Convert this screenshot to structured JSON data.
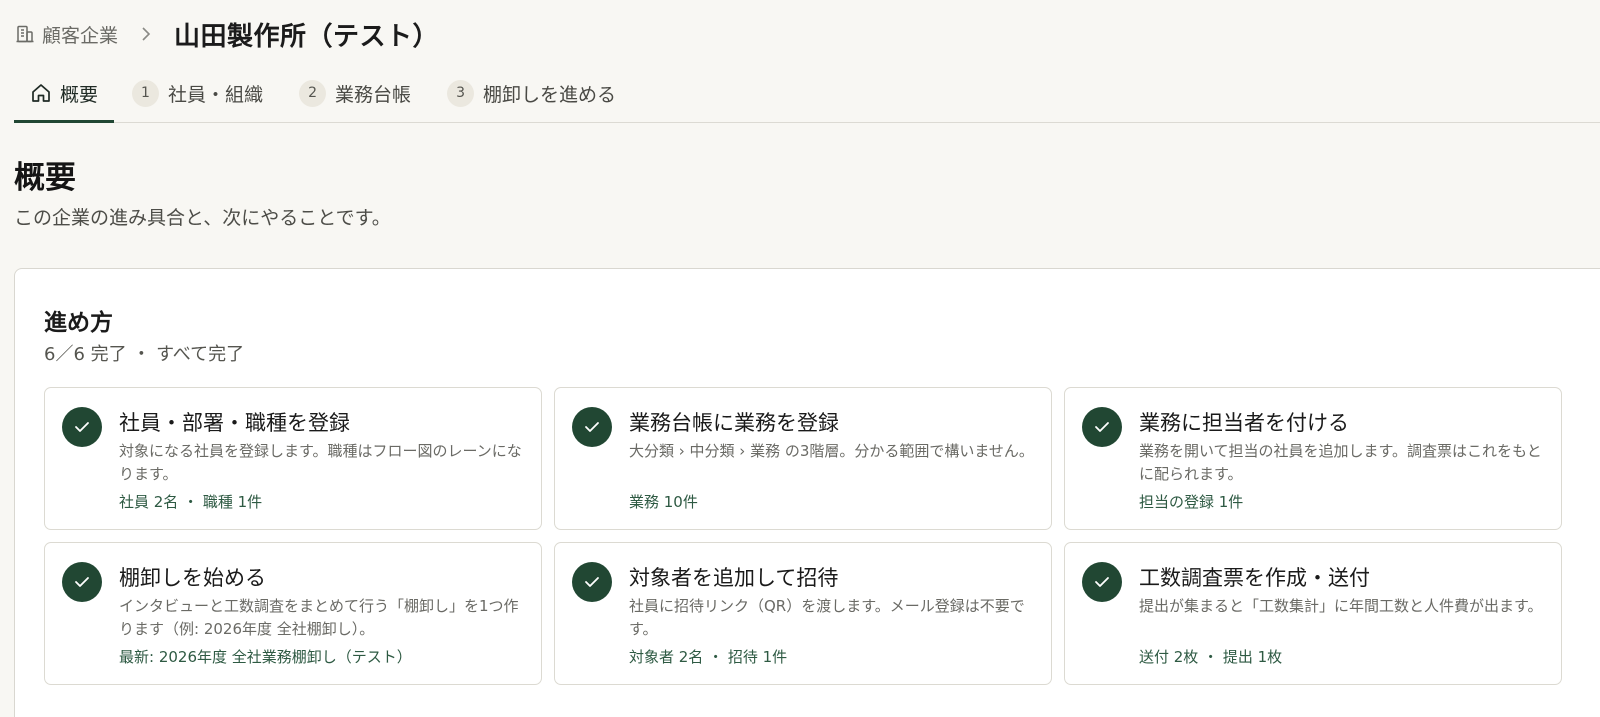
{
  "breadcrumb": {
    "parent_label": "顧客企業",
    "parent_icon": "building-icon",
    "separator": "›",
    "current_title": "山田製作所（テスト）"
  },
  "tabs": [
    {
      "label": "概要",
      "icon": "home-icon",
      "active": true
    },
    {
      "number": "1",
      "label": "社員・組織",
      "active": false
    },
    {
      "number": "2",
      "label": "業務台帳",
      "active": false
    },
    {
      "number": "3",
      "label": "棚卸しを進める",
      "active": false
    }
  ],
  "page": {
    "title": "概要",
    "subtitle": "この企業の進み具合と、次にやることです。"
  },
  "progress": {
    "title": "進め方",
    "summary": "6／6 完了 ・ すべて完了",
    "completed": 6,
    "total": 6,
    "accent_color": "#214733",
    "steps": [
      {
        "title": "社員・部署・職種を登録",
        "description": "対象になる社員を登録します。職種はフロー図のレーンになります。",
        "meta": "社員 2名 ・ 職種 1件",
        "done": true
      },
      {
        "title": "業務台帳に業務を登録",
        "description": "大分類 › 中分類 › 業務 の3階層。分かる範囲で構いません。",
        "meta": "業務 10件",
        "done": true
      },
      {
        "title": "業務に担当者を付ける",
        "description": "業務を開いて担当の社員を追加します。調査票はこれをもとに配られます。",
        "meta": "担当の登録 1件",
        "done": true
      },
      {
        "title": "棚卸しを始める",
        "description": "インタビューと工数調査をまとめて行う「棚卸し」を1つ作ります（例: 2026年度 全社棚卸し）。",
        "meta": "最新: 2026年度 全社業務棚卸し（テスト）",
        "done": true
      },
      {
        "title": "対象者を追加して招待",
        "description": "社員に招待リンク（QR）を渡します。メール登録は不要です。",
        "meta": "対象者 2名 ・ 招待 1件",
        "done": true
      },
      {
        "title": "工数調査票を作成・送付",
        "description": "提出が集まると「工数集計」に年間工数と人件費が出ます。",
        "meta": "送付 2枚 ・ 提出 1枚",
        "done": true
      }
    ]
  }
}
